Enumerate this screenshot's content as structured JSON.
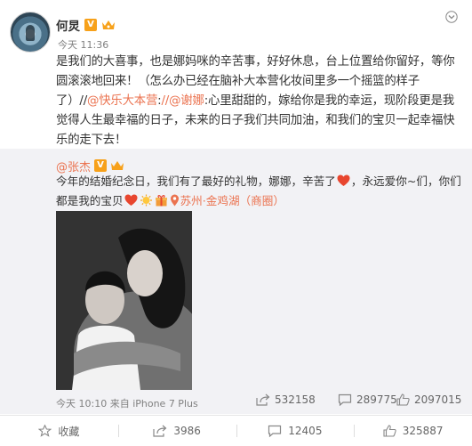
{
  "post": {
    "author": "何炅",
    "time": "今天 11:36",
    "vip_badge": "V",
    "text": {
      "part1": "是我们的大喜事，也是娜妈咪的辛苦事，好好休息，台上位置给你留好，等你圆滚滚地回来！（怎么办已经在脑补大本营化妆间里多一个摇篮的样子了）//",
      "link1": "@快乐大本营",
      "part2": ":",
      "link2": "//@谢娜",
      "part3": ":心里甜甜的，嫁给你是我的幸运，现阶段更是我觉得人生最幸福的日子，未来的日子我们共同加油，和我们的宝贝一起幸福快乐的走下去！"
    }
  },
  "repost": {
    "author": "@张杰",
    "vip_badge": "V",
    "text_part1": "今年的结婚纪念日，我们有了最好的礼物，娜娜，辛苦了",
    "text_part2": "，永远爱你~们，你们都是我的宝贝",
    "location": "苏州·金鸡湖（商圈）",
    "meta": "今天 10:10 来自 iPhone 7 Plus",
    "stats": {
      "shares": "532158",
      "comments": "289775",
      "likes": "2097015"
    }
  },
  "actions": {
    "favorite": "收藏",
    "share": "3986",
    "comment": "12405",
    "like": "325887"
  },
  "colors": {
    "link": "#eb7350",
    "badge": "#f7a11a",
    "repost_bg": "#f2f2f5",
    "heart": "#e8462f"
  },
  "icons": [
    "chevron-down-icon",
    "vip-badge-icon",
    "member-crown-icon",
    "heart-emoji-icon",
    "sun-emoji-icon",
    "gift-emoji-icon",
    "location-pin-icon",
    "share-icon",
    "comment-icon",
    "like-icon",
    "favorite-icon"
  ]
}
